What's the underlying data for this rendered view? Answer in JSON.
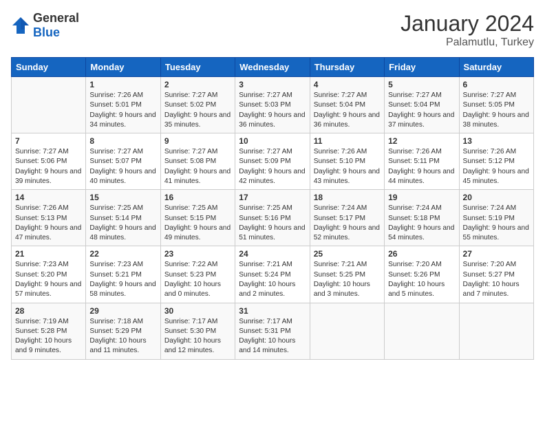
{
  "logo": {
    "general": "General",
    "blue": "Blue"
  },
  "title": "January 2024",
  "location": "Palamutlu, Turkey",
  "days_header": [
    "Sunday",
    "Monday",
    "Tuesday",
    "Wednesday",
    "Thursday",
    "Friday",
    "Saturday"
  ],
  "weeks": [
    [
      {
        "day": "",
        "sunrise": "",
        "sunset": "",
        "daylight": ""
      },
      {
        "day": "1",
        "sunrise": "Sunrise: 7:26 AM",
        "sunset": "Sunset: 5:01 PM",
        "daylight": "Daylight: 9 hours and 34 minutes."
      },
      {
        "day": "2",
        "sunrise": "Sunrise: 7:27 AM",
        "sunset": "Sunset: 5:02 PM",
        "daylight": "Daylight: 9 hours and 35 minutes."
      },
      {
        "day": "3",
        "sunrise": "Sunrise: 7:27 AM",
        "sunset": "Sunset: 5:03 PM",
        "daylight": "Daylight: 9 hours and 36 minutes."
      },
      {
        "day": "4",
        "sunrise": "Sunrise: 7:27 AM",
        "sunset": "Sunset: 5:04 PM",
        "daylight": "Daylight: 9 hours and 36 minutes."
      },
      {
        "day": "5",
        "sunrise": "Sunrise: 7:27 AM",
        "sunset": "Sunset: 5:04 PM",
        "daylight": "Daylight: 9 hours and 37 minutes."
      },
      {
        "day": "6",
        "sunrise": "Sunrise: 7:27 AM",
        "sunset": "Sunset: 5:05 PM",
        "daylight": "Daylight: 9 hours and 38 minutes."
      }
    ],
    [
      {
        "day": "7",
        "sunrise": "Sunrise: 7:27 AM",
        "sunset": "Sunset: 5:06 PM",
        "daylight": "Daylight: 9 hours and 39 minutes."
      },
      {
        "day": "8",
        "sunrise": "Sunrise: 7:27 AM",
        "sunset": "Sunset: 5:07 PM",
        "daylight": "Daylight: 9 hours and 40 minutes."
      },
      {
        "day": "9",
        "sunrise": "Sunrise: 7:27 AM",
        "sunset": "Sunset: 5:08 PM",
        "daylight": "Daylight: 9 hours and 41 minutes."
      },
      {
        "day": "10",
        "sunrise": "Sunrise: 7:27 AM",
        "sunset": "Sunset: 5:09 PM",
        "daylight": "Daylight: 9 hours and 42 minutes."
      },
      {
        "day": "11",
        "sunrise": "Sunrise: 7:26 AM",
        "sunset": "Sunset: 5:10 PM",
        "daylight": "Daylight: 9 hours and 43 minutes."
      },
      {
        "day": "12",
        "sunrise": "Sunrise: 7:26 AM",
        "sunset": "Sunset: 5:11 PM",
        "daylight": "Daylight: 9 hours and 44 minutes."
      },
      {
        "day": "13",
        "sunrise": "Sunrise: 7:26 AM",
        "sunset": "Sunset: 5:12 PM",
        "daylight": "Daylight: 9 hours and 45 minutes."
      }
    ],
    [
      {
        "day": "14",
        "sunrise": "Sunrise: 7:26 AM",
        "sunset": "Sunset: 5:13 PM",
        "daylight": "Daylight: 9 hours and 47 minutes."
      },
      {
        "day": "15",
        "sunrise": "Sunrise: 7:25 AM",
        "sunset": "Sunset: 5:14 PM",
        "daylight": "Daylight: 9 hours and 48 minutes."
      },
      {
        "day": "16",
        "sunrise": "Sunrise: 7:25 AM",
        "sunset": "Sunset: 5:15 PM",
        "daylight": "Daylight: 9 hours and 49 minutes."
      },
      {
        "day": "17",
        "sunrise": "Sunrise: 7:25 AM",
        "sunset": "Sunset: 5:16 PM",
        "daylight": "Daylight: 9 hours and 51 minutes."
      },
      {
        "day": "18",
        "sunrise": "Sunrise: 7:24 AM",
        "sunset": "Sunset: 5:17 PM",
        "daylight": "Daylight: 9 hours and 52 minutes."
      },
      {
        "day": "19",
        "sunrise": "Sunrise: 7:24 AM",
        "sunset": "Sunset: 5:18 PM",
        "daylight": "Daylight: 9 hours and 54 minutes."
      },
      {
        "day": "20",
        "sunrise": "Sunrise: 7:24 AM",
        "sunset": "Sunset: 5:19 PM",
        "daylight": "Daylight: 9 hours and 55 minutes."
      }
    ],
    [
      {
        "day": "21",
        "sunrise": "Sunrise: 7:23 AM",
        "sunset": "Sunset: 5:20 PM",
        "daylight": "Daylight: 9 hours and 57 minutes."
      },
      {
        "day": "22",
        "sunrise": "Sunrise: 7:23 AM",
        "sunset": "Sunset: 5:21 PM",
        "daylight": "Daylight: 9 hours and 58 minutes."
      },
      {
        "day": "23",
        "sunrise": "Sunrise: 7:22 AM",
        "sunset": "Sunset: 5:23 PM",
        "daylight": "Daylight: 10 hours and 0 minutes."
      },
      {
        "day": "24",
        "sunrise": "Sunrise: 7:21 AM",
        "sunset": "Sunset: 5:24 PM",
        "daylight": "Daylight: 10 hours and 2 minutes."
      },
      {
        "day": "25",
        "sunrise": "Sunrise: 7:21 AM",
        "sunset": "Sunset: 5:25 PM",
        "daylight": "Daylight: 10 hours and 3 minutes."
      },
      {
        "day": "26",
        "sunrise": "Sunrise: 7:20 AM",
        "sunset": "Sunset: 5:26 PM",
        "daylight": "Daylight: 10 hours and 5 minutes."
      },
      {
        "day": "27",
        "sunrise": "Sunrise: 7:20 AM",
        "sunset": "Sunset: 5:27 PM",
        "daylight": "Daylight: 10 hours and 7 minutes."
      }
    ],
    [
      {
        "day": "28",
        "sunrise": "Sunrise: 7:19 AM",
        "sunset": "Sunset: 5:28 PM",
        "daylight": "Daylight: 10 hours and 9 minutes."
      },
      {
        "day": "29",
        "sunrise": "Sunrise: 7:18 AM",
        "sunset": "Sunset: 5:29 PM",
        "daylight": "Daylight: 10 hours and 11 minutes."
      },
      {
        "day": "30",
        "sunrise": "Sunrise: 7:17 AM",
        "sunset": "Sunset: 5:30 PM",
        "daylight": "Daylight: 10 hours and 12 minutes."
      },
      {
        "day": "31",
        "sunrise": "Sunrise: 7:17 AM",
        "sunset": "Sunset: 5:31 PM",
        "daylight": "Daylight: 10 hours and 14 minutes."
      },
      {
        "day": "",
        "sunrise": "",
        "sunset": "",
        "daylight": ""
      },
      {
        "day": "",
        "sunrise": "",
        "sunset": "",
        "daylight": ""
      },
      {
        "day": "",
        "sunrise": "",
        "sunset": "",
        "daylight": ""
      }
    ]
  ]
}
